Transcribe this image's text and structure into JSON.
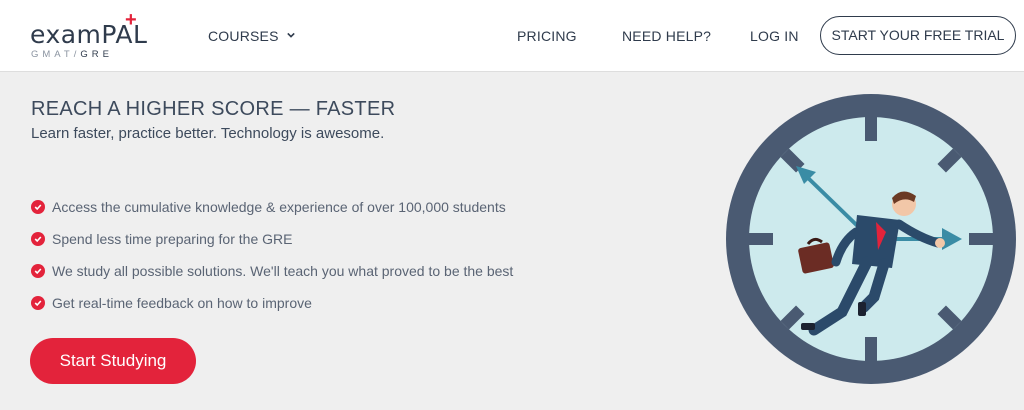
{
  "brand": {
    "name": "examPAL",
    "plus": "+",
    "sub_left": "GMAT/",
    "sub_right": "GRE"
  },
  "nav": {
    "courses": "COURSES",
    "pricing": "PRICING",
    "help": "NEED HELP?",
    "login": "LOG IN",
    "trial": "START YOUR FREE TRIAL"
  },
  "hero": {
    "headline": "REACH A HIGHER SCORE — FASTER",
    "subline": "Learn faster, practice better. Technology is awesome.",
    "features": [
      "Access the cumulative knowledge & experience of over 100,000 students",
      "Spend less time preparing for the GRE",
      "We study all possible solutions. We'll teach you what proved to be the best",
      "Get real-time feedback on how to improve"
    ],
    "cta": "Start Studying"
  },
  "colors": {
    "accent": "#e3233b",
    "text_dark": "#2f3b4c",
    "background": "#efefef",
    "clock_face": "#cdeaed",
    "clock_rim": "#4a5a72",
    "arrow": "#3a8ca5"
  },
  "icons": [
    "chevron-down-icon",
    "check-circle-icon",
    "clock-runner-illustration"
  ]
}
